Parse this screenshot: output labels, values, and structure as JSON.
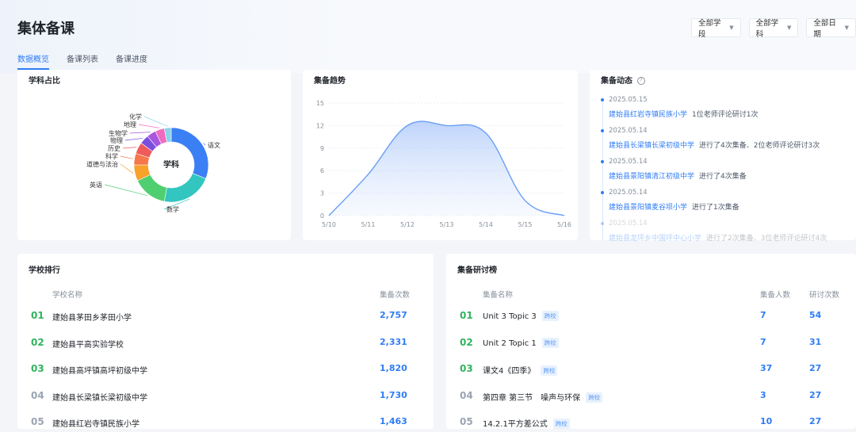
{
  "header": {
    "title": "集体备课",
    "tabs": [
      {
        "label": "数据概览",
        "active": true
      },
      {
        "label": "备课列表",
        "active": false
      },
      {
        "label": "备课进度",
        "active": false
      }
    ],
    "filters": [
      "全部学段",
      "全部学科",
      "全部日期"
    ]
  },
  "subject_card": {
    "title": "学科占比",
    "center_label": "学科"
  },
  "trend_card": {
    "title": "集备趋势"
  },
  "activity_card": {
    "title": "集备动态",
    "items": [
      {
        "date": "2025.05.15",
        "school": "建始县红岩寺镇民族小学",
        "desc": "1位老师评论研讨1次"
      },
      {
        "date": "2025.05.14",
        "school": "建始县长梁镇长梁初级中学",
        "desc": "进行了4次集备、2位老师评论研讨3次"
      },
      {
        "date": "2025.05.14",
        "school": "建始县景阳镇清江初级中学",
        "desc": "进行了4次集备"
      },
      {
        "date": "2025.05.14",
        "school": "建始县景阳镇麦谷坝小学",
        "desc": "进行了1次集备"
      },
      {
        "date": "2025.05.14",
        "school": "建始县龙坪乡中国坪中心小学",
        "desc": "进行了2次集备、3位老师评论研讨4次"
      }
    ]
  },
  "school_card": {
    "title": "学校排行",
    "col_name": "学校名称",
    "col_count": "集备次数",
    "rows": [
      {
        "rank": "01",
        "name": "建始县茅田乡茅田小学",
        "count": "2,757"
      },
      {
        "rank": "02",
        "name": "建始县平高实验学校",
        "count": "2,331"
      },
      {
        "rank": "03",
        "name": "建始县高坪镇高坪初级中学",
        "count": "1,820"
      },
      {
        "rank": "04",
        "name": "建始县长梁镇长梁初级中学",
        "count": "1,730"
      },
      {
        "rank": "05",
        "name": "建始县红岩寺镇民族小学",
        "count": "1,463"
      }
    ]
  },
  "discuss_card": {
    "title": "集备研讨榜",
    "col_name": "集备名称",
    "col_people": "集备人数",
    "col_count": "研讨次数",
    "rows": [
      {
        "rank": "01",
        "name": "Unit 3 Topic 3",
        "tag": "跨校",
        "people": "7",
        "count": "54"
      },
      {
        "rank": "02",
        "name": "Unit 2 Topic 1",
        "tag": "跨校",
        "people": "7",
        "count": "31"
      },
      {
        "rank": "03",
        "name": "课文4《四季》",
        "tag": "跨校",
        "people": "37",
        "count": "27"
      },
      {
        "rank": "04",
        "name": "第四章 第三节　噪声与环保",
        "tag": "跨校",
        "people": "3",
        "count": "27"
      },
      {
        "rank": "05",
        "name": "14.2.1平方差公式",
        "tag": "跨校",
        "people": "10",
        "count": "27"
      }
    ]
  },
  "chart_data": [
    {
      "type": "pie",
      "title": "学科占比",
      "center_label": "学科",
      "categories": [
        "语文",
        "数学",
        "英语",
        "道德与法治",
        "科学",
        "历史",
        "物理",
        "生物学",
        "地理",
        "化学"
      ],
      "values": [
        31,
        22,
        15,
        7,
        5,
        5,
        4,
        4,
        4,
        3
      ],
      "colors": [
        "#3b7ff5",
        "#33c5c0",
        "#4fcf70",
        "#f7a22b",
        "#f5774a",
        "#ef5b5b",
        "#7a4fe0",
        "#a855e0",
        "#f06bbf",
        "#8bd3e8"
      ]
    },
    {
      "type": "area",
      "title": "集备趋势",
      "x": [
        "5/10",
        "5/11",
        "5/12",
        "5/13",
        "5/14",
        "5/15",
        "5/16"
      ],
      "yticks": [
        0,
        3,
        6,
        9,
        12,
        15
      ],
      "ylim": [
        0,
        15
      ],
      "series": [
        {
          "values": [
            0,
            5.5,
            12,
            12,
            11,
            2,
            0
          ],
          "color": "#6a9ef6"
        }
      ]
    }
  ]
}
